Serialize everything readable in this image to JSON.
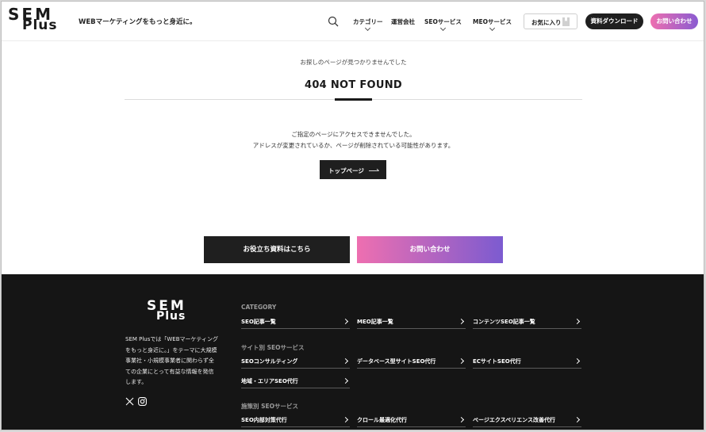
{
  "header": {
    "logo_line1": "SEM",
    "logo_line2": "Plus",
    "tagline": "WEBマーケティングをもっと身近に。",
    "nav": [
      {
        "label": "カテゴリー",
        "has_dropdown": true
      },
      {
        "label": "運営会社",
        "has_dropdown": false
      },
      {
        "label": "SEOサービス",
        "has_dropdown": true
      },
      {
        "label": "MEOサービス",
        "has_dropdown": true
      }
    ],
    "favorites_label": "お気に入り",
    "download_label": "資料ダウンロード",
    "contact_label": "お問い合わせ"
  },
  "main": {
    "lead": "お探しのページが見つかりませんでした",
    "title": "404 NOT FOUND",
    "message_line1": "ご指定のページにアクセスできませんでした。",
    "message_line2": "アドレスが変更されているか、ページが削除されている可能性があります。",
    "top_button_label": "トップページ"
  },
  "cta": {
    "documents_label": "お役立ち資料はこちら",
    "contact_label": "お問い合わせ"
  },
  "footer": {
    "logo_line1": "SEM",
    "logo_line2": "Plus",
    "description": "SEM Plusでは「WEBマーケティングをもっと身近に。」をテーマに大規模事業社・小規模事業者に関わらず全ての企業にとって有益な情報を発信します。",
    "category_heading": "CATEGORY",
    "category_links": [
      "SEO記事一覧",
      "MEO記事一覧",
      "コンテンツSEO記事一覧"
    ],
    "site_seo_heading": "サイト別 SEOサービス",
    "site_seo_links": [
      "SEOコンサルティング",
      "データベース型サイトSEO代行",
      "ECサイトSEO代行",
      "地域・エリアSEO代行"
    ],
    "measure_seo_heading": "施策別 SEOサービス",
    "measure_seo_links": [
      "SEO内部対策代行",
      "クロール最適化代行",
      "ページエクスペリエンス改善代行"
    ]
  },
  "colors": {
    "dark": "#1f1f1f",
    "gradient_start": "#ee6fb0",
    "gradient_end": "#7c5bd0",
    "footer_bg": "#151515"
  },
  "icons": [
    "search-icon",
    "chevron-down-icon",
    "bookmark-icon",
    "arrow-right-icon",
    "x-icon",
    "instagram-icon",
    "chevron-right-icon"
  ]
}
